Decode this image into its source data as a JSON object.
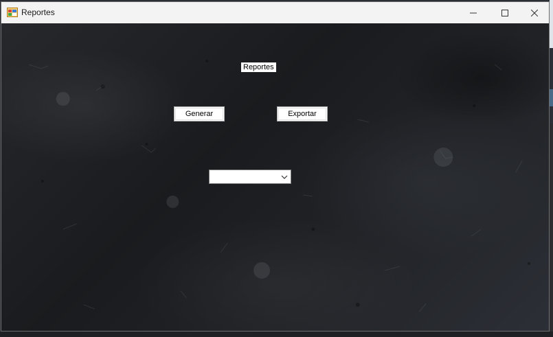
{
  "window": {
    "title": "Reportes",
    "controls": [
      "minimize-icon",
      "maximize-icon",
      "close-icon"
    ]
  },
  "form": {
    "heading_label": "Reportes",
    "generate_button": "Generar",
    "export_button": "Exportar",
    "report_select": {
      "value": "",
      "options": []
    }
  },
  "colors": {
    "titlebar": "#f3f3f3",
    "background": "#1d1e21",
    "control_face": "#ffffff"
  }
}
